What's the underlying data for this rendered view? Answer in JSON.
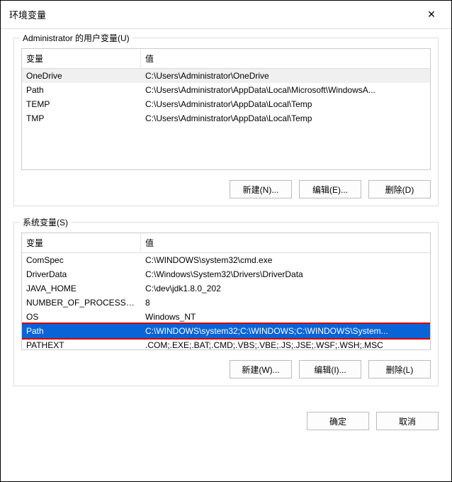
{
  "title": "环境变量",
  "closeIcon": "✕",
  "columns": {
    "name": "变量",
    "value": "值"
  },
  "userGroup": {
    "label": "Administrator 的用户变量(U)",
    "rows": [
      {
        "name": "OneDrive",
        "value": "C:\\Users\\Administrator\\OneDrive",
        "selected": true
      },
      {
        "name": "Path",
        "value": "C:\\Users\\Administrator\\AppData\\Local\\Microsoft\\WindowsA..."
      },
      {
        "name": "TEMP",
        "value": "C:\\Users\\Administrator\\AppData\\Local\\Temp"
      },
      {
        "name": "TMP",
        "value": "C:\\Users\\Administrator\\AppData\\Local\\Temp"
      }
    ],
    "buttons": {
      "new": "新建(N)...",
      "edit": "编辑(E)...",
      "del": "删除(D)"
    }
  },
  "sysGroup": {
    "label": "系统变量(S)",
    "rows": [
      {
        "name": "ComSpec",
        "value": "C:\\WINDOWS\\system32\\cmd.exe"
      },
      {
        "name": "DriverData",
        "value": "C:\\Windows\\System32\\Drivers\\DriverData"
      },
      {
        "name": "JAVA_HOME",
        "value": "C:\\dev\\jdk1.8.0_202"
      },
      {
        "name": "NUMBER_OF_PROCESSORS",
        "value": "8"
      },
      {
        "name": "OS",
        "value": "Windows_NT"
      },
      {
        "name": "Path",
        "value": "C:\\WINDOWS\\system32;C:\\WINDOWS;C:\\WINDOWS\\System...",
        "selected": true,
        "highlight": true
      },
      {
        "name": "PATHEXT",
        "value": ".COM;.EXE;.BAT;.CMD;.VBS;.VBE;.JS;.JSE;.WSF;.WSH;.MSC"
      }
    ],
    "buttons": {
      "new": "新建(W)...",
      "edit": "编辑(I)...",
      "del": "删除(L)"
    }
  },
  "footer": {
    "ok": "确定",
    "cancel": "取消"
  }
}
